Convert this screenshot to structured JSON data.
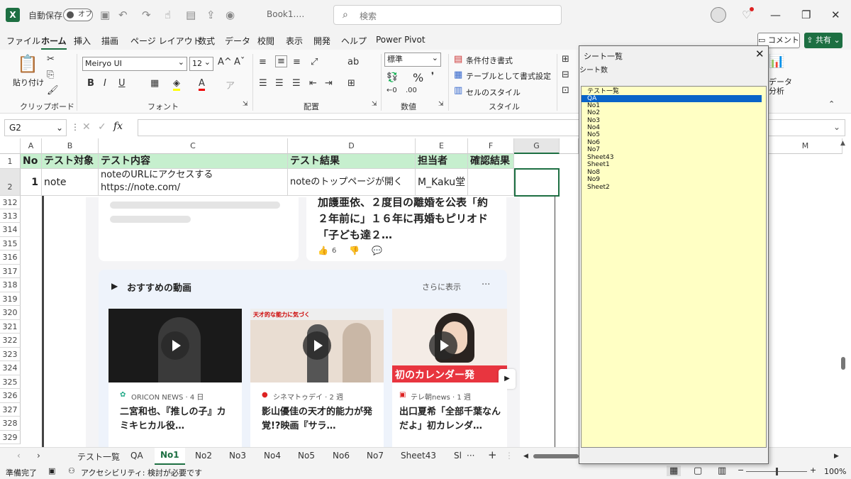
{
  "titlebar": {
    "autosave_label": "自動保存",
    "autosave_state": "オフ",
    "filename": "Book1.…",
    "search_placeholder": "検索"
  },
  "ribbon_tabs": [
    "ファイル",
    "ホーム",
    "挿入",
    "描画",
    "ページ レイアウト",
    "数式",
    "データ",
    "校閲",
    "表示",
    "開発",
    "ヘルプ",
    "Power Pivot"
  ],
  "header_buttons": {
    "comment": "コメント",
    "share": "共有"
  },
  "ribbon": {
    "paste_label": "貼り付け",
    "clipboard_label": "クリップボード",
    "font_name": "Meiryo UI",
    "font_size": "12",
    "font_label": "フォント",
    "align_label": "配置",
    "number_format": "標準",
    "number_label": "数値",
    "conditional": "条件付き書式",
    "table_format": "テーブルとして書式設定",
    "cell_style": "セルのスタイル",
    "style_label": "スタイル",
    "data_analysis_1": "データ",
    "data_analysis_2": "分析"
  },
  "formula_bar": {
    "namebox": "G2",
    "fx": "fx"
  },
  "columns": [
    "A",
    "B",
    "C",
    "D",
    "E",
    "F",
    "G",
    "M"
  ],
  "row_numbers": [
    "1",
    "2",
    "312",
    "313",
    "314",
    "315",
    "316",
    "317",
    "318",
    "319",
    "320",
    "321",
    "322",
    "323",
    "324",
    "325",
    "326",
    "327",
    "328",
    "329"
  ],
  "table": {
    "headers": [
      "No",
      "テスト対象",
      "テスト内容",
      "テスト結果",
      "担当者",
      "確認結果"
    ],
    "row": {
      "no": "1",
      "target": "note",
      "content_line1": "noteのURLにアクセスする",
      "content_line2": "https://note.com/",
      "result": "noteのトップページが開く",
      "owner": "M_Kaku堂"
    }
  },
  "embedded": {
    "news_title": "加護亜依、２度目の離婚を公表「約２年前に」１６年に再婚もピリオド「子ども達２…",
    "likes": "6",
    "section_title": "おすすめの動画",
    "more": "さらに表示",
    "videos": [
      {
        "source": "ORICON NEWS · 4 日",
        "title": "二宮和也、『推しの子』カミキヒカル役…"
      },
      {
        "source": "シネマトゥデイ · 2 週",
        "title": "影山優佳の天才的能力が発覚!?映画『サラ…",
        "banner": "天才的な能力に気づく"
      },
      {
        "source": "テレ朝news · 1 週",
        "title": "出口夏希「全部千葉なんだよ」初カレンダ…",
        "banner": "初のカレンダー発"
      }
    ]
  },
  "sheet_tabs": [
    "テスト一覧",
    "QA",
    "No1",
    "No2",
    "No3",
    "No4",
    "No5",
    "No6",
    "No7",
    "Sheet43",
    "Sl"
  ],
  "status": {
    "ready": "準備完了",
    "accessibility": "アクセシビリティ: 検討が必要です",
    "zoom": "100%"
  },
  "dialog": {
    "title": "シート一覧",
    "count_label": "シート数",
    "sheets": [
      "テスト一覧",
      "QA",
      "No1",
      "No2",
      "No3",
      "No4",
      "No5",
      "No6",
      "No7",
      "Sheet43",
      "Sheet1",
      "No8",
      "No9",
      "Sheet2"
    ],
    "selected": "QA"
  },
  "colors": {
    "excel_green": "#1d6f42",
    "header_fill": "#c6efce",
    "list_bg": "#ffffc4",
    "selection": "#0a64c8"
  }
}
